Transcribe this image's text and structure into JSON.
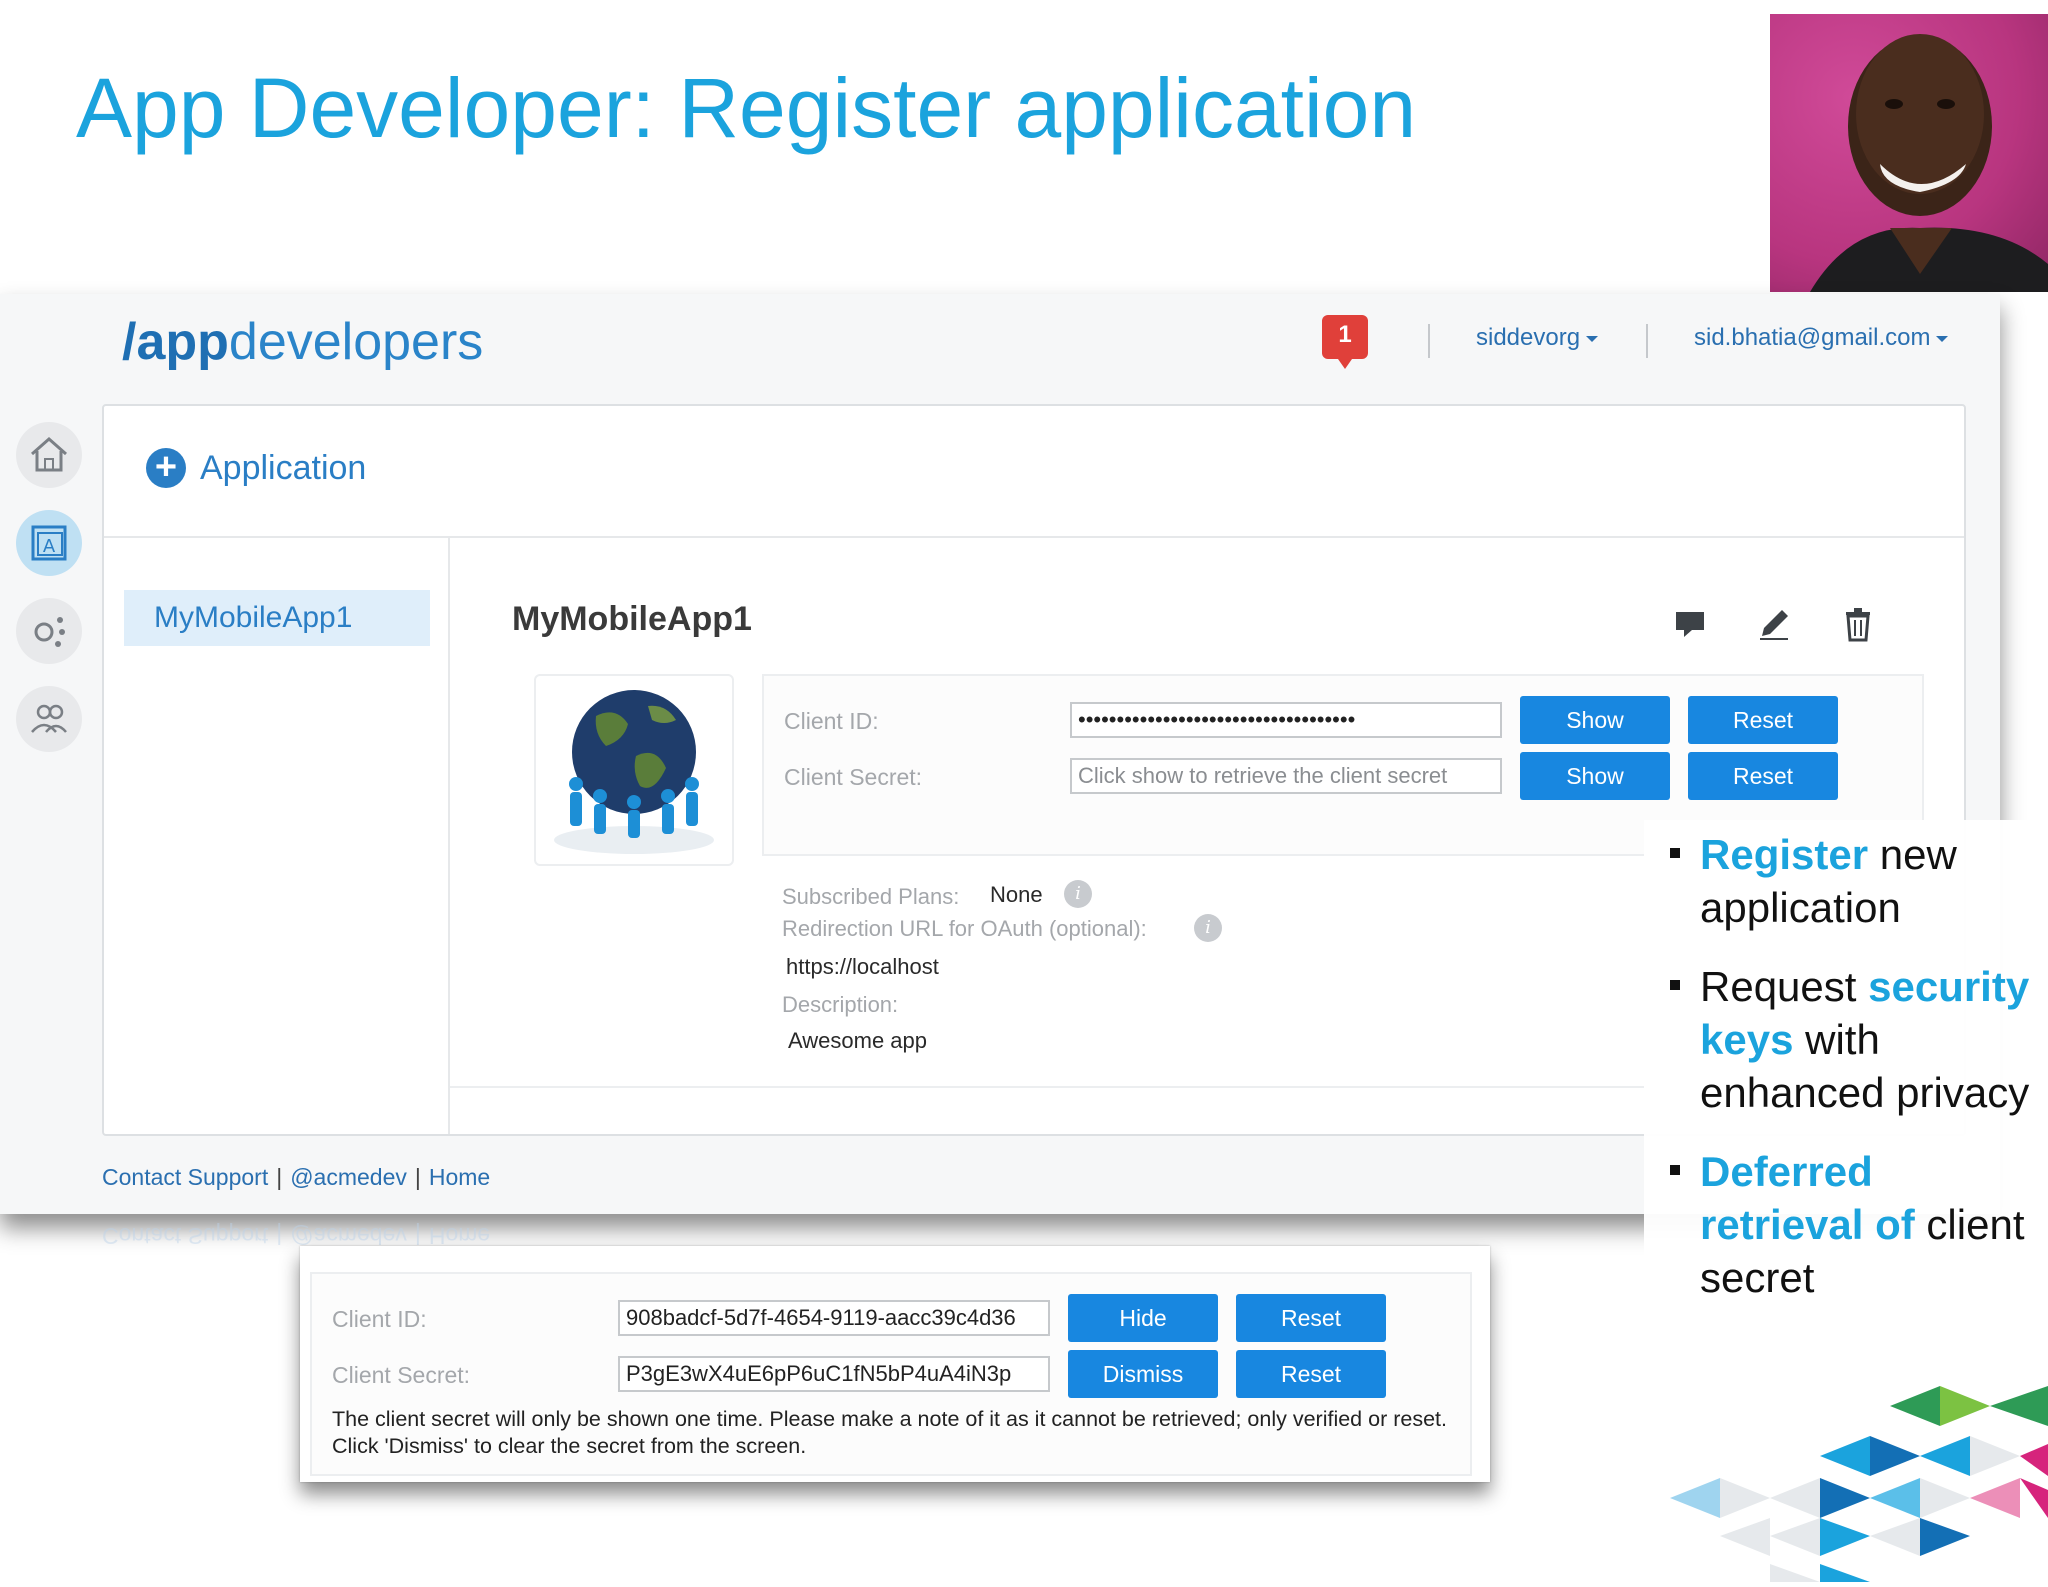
{
  "slide": {
    "title": "App Developer: Register application"
  },
  "header": {
    "brand_prefix": "/app",
    "brand_suffix": "developers",
    "notification_count": "1",
    "org_label": "siddevorg",
    "user_label": "sid.bhatia@gmail.com"
  },
  "rail": {
    "icons": [
      "home-icon",
      "apps-icon",
      "analytics-icon",
      "users-icon"
    ]
  },
  "panel": {
    "add_label": "Application",
    "side_item": "MyMobileApp1",
    "app_title": "MyMobileApp1",
    "actions": [
      "comment-icon",
      "edit-icon",
      "delete-icon"
    ]
  },
  "keys": {
    "client_id_label": "Client ID:",
    "client_id_value": "••••••••••••••••••••••••••••••••••••",
    "client_secret_label": "Client Secret:",
    "client_secret_placeholder": "Click show to retrieve the client secret",
    "show_label": "Show",
    "reset_label": "Reset"
  },
  "details": {
    "plans_label": "Subscribed Plans:",
    "plans_value": "None",
    "redirect_label": "Redirection URL for OAuth (optional):",
    "redirect_value": "https://localhost",
    "description_label": "Description:",
    "description_value": "Awesome app",
    "info_glyph": "i"
  },
  "footer": {
    "contact": "Contact Support",
    "twitter": "@acmedev",
    "home": "Home",
    "separator": "|"
  },
  "inset": {
    "client_id_label": "Client ID:",
    "client_id_value": "908badcf-5d7f-4654-9119-aacc39c4d36",
    "client_secret_label": "Client Secret:",
    "client_secret_value": "P3gE3wX4uE6pP6uC1fN5bP4uA4iN3p",
    "hide_label": "Hide",
    "dismiss_label": "Dismiss",
    "reset_label": "Reset",
    "note": "The client secret will only be shown one time. Please make a note of it as it cannot be retrieved; only verified or reset. Click 'Dismiss' to clear the secret from the screen."
  },
  "bullets": [
    {
      "highlight": "Register",
      "rest": " new application"
    },
    {
      "pre": "Request ",
      "highlight": "security keys",
      "rest": " with enhanced privacy"
    },
    {
      "highlight": "Deferred retrieval of",
      "rest": " client secret"
    }
  ],
  "colors": {
    "accent": "#1ba3dd",
    "button": "#1887e0",
    "notification": "#e0403a",
    "photo_bg": "#b8357f"
  }
}
